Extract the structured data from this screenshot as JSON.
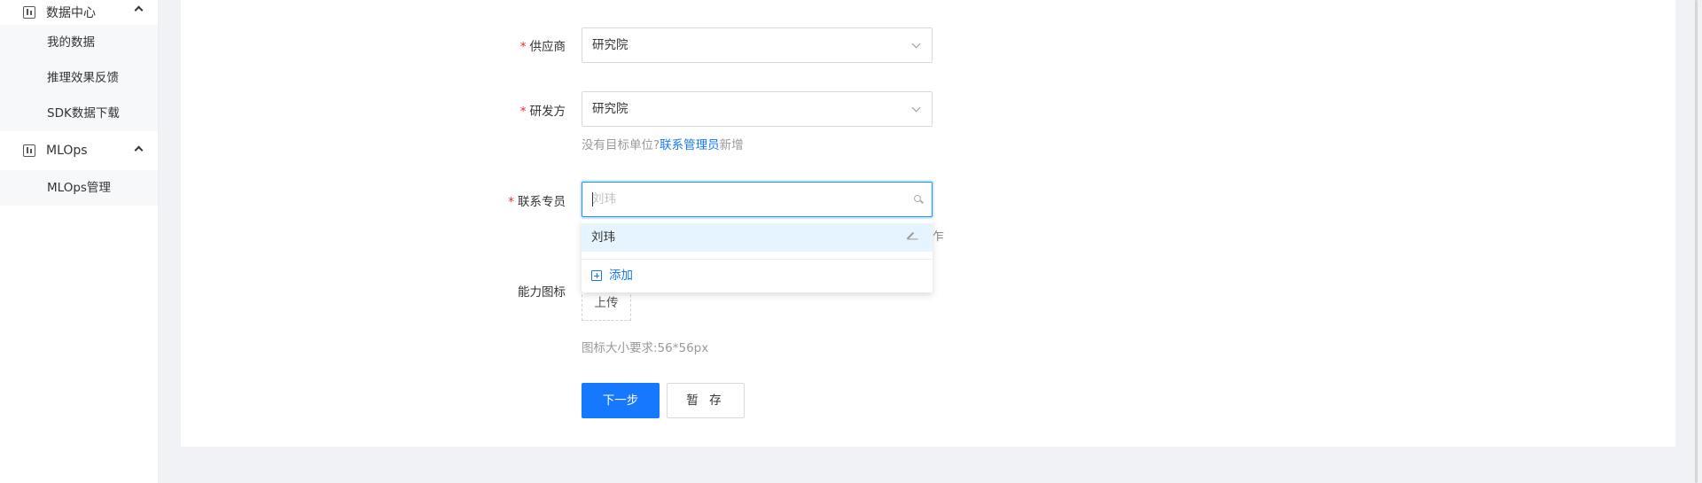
{
  "sidebar": {
    "groups": [
      {
        "title": "数据中心",
        "items": [
          "我的数据",
          "推理效果反馈",
          "SDK数据下载"
        ]
      },
      {
        "title": "MLOps",
        "items": [
          "MLOps管理"
        ]
      }
    ]
  },
  "form": {
    "supplier": {
      "label": "供应商",
      "value": "研究院"
    },
    "developer": {
      "label": "研发方",
      "value": "研究院"
    },
    "hint": {
      "prefix": "没有目标单位?",
      "link": "联系管理员",
      "suffix": "新增"
    },
    "contact": {
      "label": "联系专员",
      "placeholder": "刘玮"
    },
    "dropdown": {
      "option": "刘玮",
      "add_label": "添加"
    },
    "icon": {
      "label": "能力图标",
      "upload_label": "上传",
      "requirement": "图标大小要求:56*56px"
    },
    "buttons": {
      "next": "下一步",
      "save": "暂 存"
    },
    "peek_text": "乍"
  },
  "colors": {
    "primary": "#1677ff",
    "required": "#f5222d",
    "hint": "#999999"
  }
}
